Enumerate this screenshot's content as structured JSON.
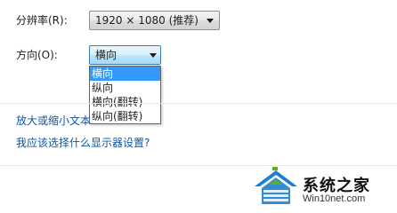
{
  "resolution": {
    "label": "分辨率(R):",
    "value": "1920 × 1080 (推荐)"
  },
  "orientation": {
    "label": "方向(O):",
    "value": "横向",
    "options": [
      "横向",
      "纵向",
      "横向(翻转)",
      "纵向(翻转)"
    ],
    "selected_index": 0
  },
  "links": {
    "text_size": "放大或缩小文本",
    "which_settings": "我应该选择什么显示器设置?"
  },
  "watermark": {
    "name": "系统之家",
    "url": "Win10net.com",
    "colors": {
      "blue": "#1e7fd0",
      "green": "#5cae2e"
    }
  },
  "colors": {
    "link": "#0f57a0",
    "selection": "#3399ff"
  }
}
